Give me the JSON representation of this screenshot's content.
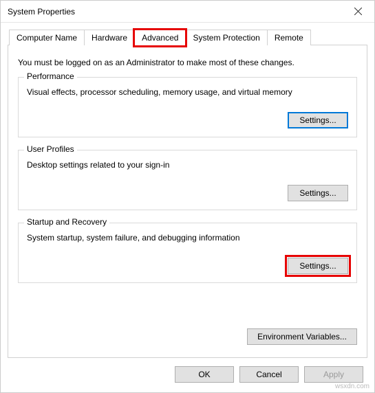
{
  "window": {
    "title": "System Properties",
    "close_icon": "close"
  },
  "tabs": {
    "computer_name": "Computer Name",
    "hardware": "Hardware",
    "advanced": "Advanced",
    "system_protection": "System Protection",
    "remote": "Remote",
    "active": "advanced"
  },
  "panel": {
    "intro": "You must be logged on as an Administrator to make most of these changes."
  },
  "groups": {
    "performance": {
      "legend": "Performance",
      "desc": "Visual effects, processor scheduling, memory usage, and virtual memory",
      "button": "Settings..."
    },
    "user_profiles": {
      "legend": "User Profiles",
      "desc": "Desktop settings related to your sign-in",
      "button": "Settings..."
    },
    "startup_recovery": {
      "legend": "Startup and Recovery",
      "desc": "System startup, system failure, and debugging information",
      "button": "Settings..."
    }
  },
  "env_button": "Environment Variables...",
  "buttons": {
    "ok": "OK",
    "cancel": "Cancel",
    "apply": "Apply"
  },
  "watermark": "wsxdn.com"
}
